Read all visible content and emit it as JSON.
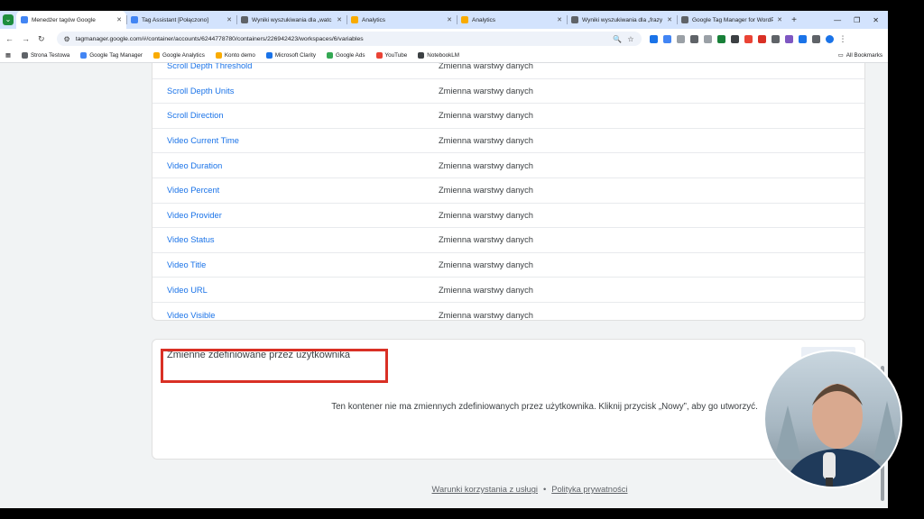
{
  "browser": {
    "tabs": [
      {
        "label": "Menedżer tagów Google",
        "active": true,
        "color": "#4285f4"
      },
      {
        "label": "Tag Assistant [Połączono]",
        "active": false,
        "color": "#4285f4"
      },
      {
        "label": "Wyniki wyszukiwania dla „watc",
        "active": false,
        "color": "#5f6368"
      },
      {
        "label": "Analytics",
        "active": false,
        "color": "#f9ab00"
      },
      {
        "label": "Analytics",
        "active": false,
        "color": "#f9ab00"
      },
      {
        "label": "Wyniki wyszukiwania dla „frazy",
        "active": false,
        "color": "#5f6368"
      },
      {
        "label": "Google Tag Manager for WordP",
        "active": false,
        "color": "#5f6368"
      }
    ],
    "url": "tagmanager.google.com/#/container/accounts/6244778780/containers/226942423/workspaces/6/variables",
    "bookmarks": [
      {
        "label": "Strona Testowa",
        "color": "#5f6368"
      },
      {
        "label": "Google Tag Manager",
        "color": "#4285f4"
      },
      {
        "label": "Google Analytics",
        "color": "#f9ab00"
      },
      {
        "label": "Konto demo",
        "color": "#f9ab00"
      },
      {
        "label": "Microsoft Clarity",
        "color": "#1a73e8"
      },
      {
        "label": "Google Ads",
        "color": "#34a853"
      },
      {
        "label": "YouTube",
        "color": "#ea4335"
      },
      {
        "label": "NotebookLM",
        "color": "#3c4043"
      }
    ],
    "all_bookmarks": "All Bookmarks"
  },
  "builtin_variables": [
    {
      "name": "Scroll Depth Threshold",
      "type": "Zmienna warstwy danych"
    },
    {
      "name": "Scroll Depth Units",
      "type": "Zmienna warstwy danych"
    },
    {
      "name": "Scroll Direction",
      "type": "Zmienna warstwy danych"
    },
    {
      "name": "Video Current Time",
      "type": "Zmienna warstwy danych"
    },
    {
      "name": "Video Duration",
      "type": "Zmienna warstwy danych"
    },
    {
      "name": "Video Percent",
      "type": "Zmienna warstwy danych"
    },
    {
      "name": "Video Provider",
      "type": "Zmienna warstwy danych"
    },
    {
      "name": "Video Status",
      "type": "Zmienna warstwy danych"
    },
    {
      "name": "Video Title",
      "type": "Zmienna warstwy danych"
    },
    {
      "name": "Video URL",
      "type": "Zmienna warstwy danych"
    },
    {
      "name": "Video Visible",
      "type": "Zmienna warstwy danych"
    }
  ],
  "user_variables": {
    "title": "Zmienne zdefiniowane przez użytkownika",
    "empty_message": "Ten kontener nie ma zmiennych zdefiniowanych przez użytkownika. Kliknij przycisk „Nowy”, aby go utworzyć."
  },
  "footer": {
    "terms": "Warunki korzystania z usługi",
    "separator": "•",
    "privacy": "Polityka prywatności"
  },
  "colors": {
    "link": "#1a73e8",
    "highlight": "#d93025"
  }
}
